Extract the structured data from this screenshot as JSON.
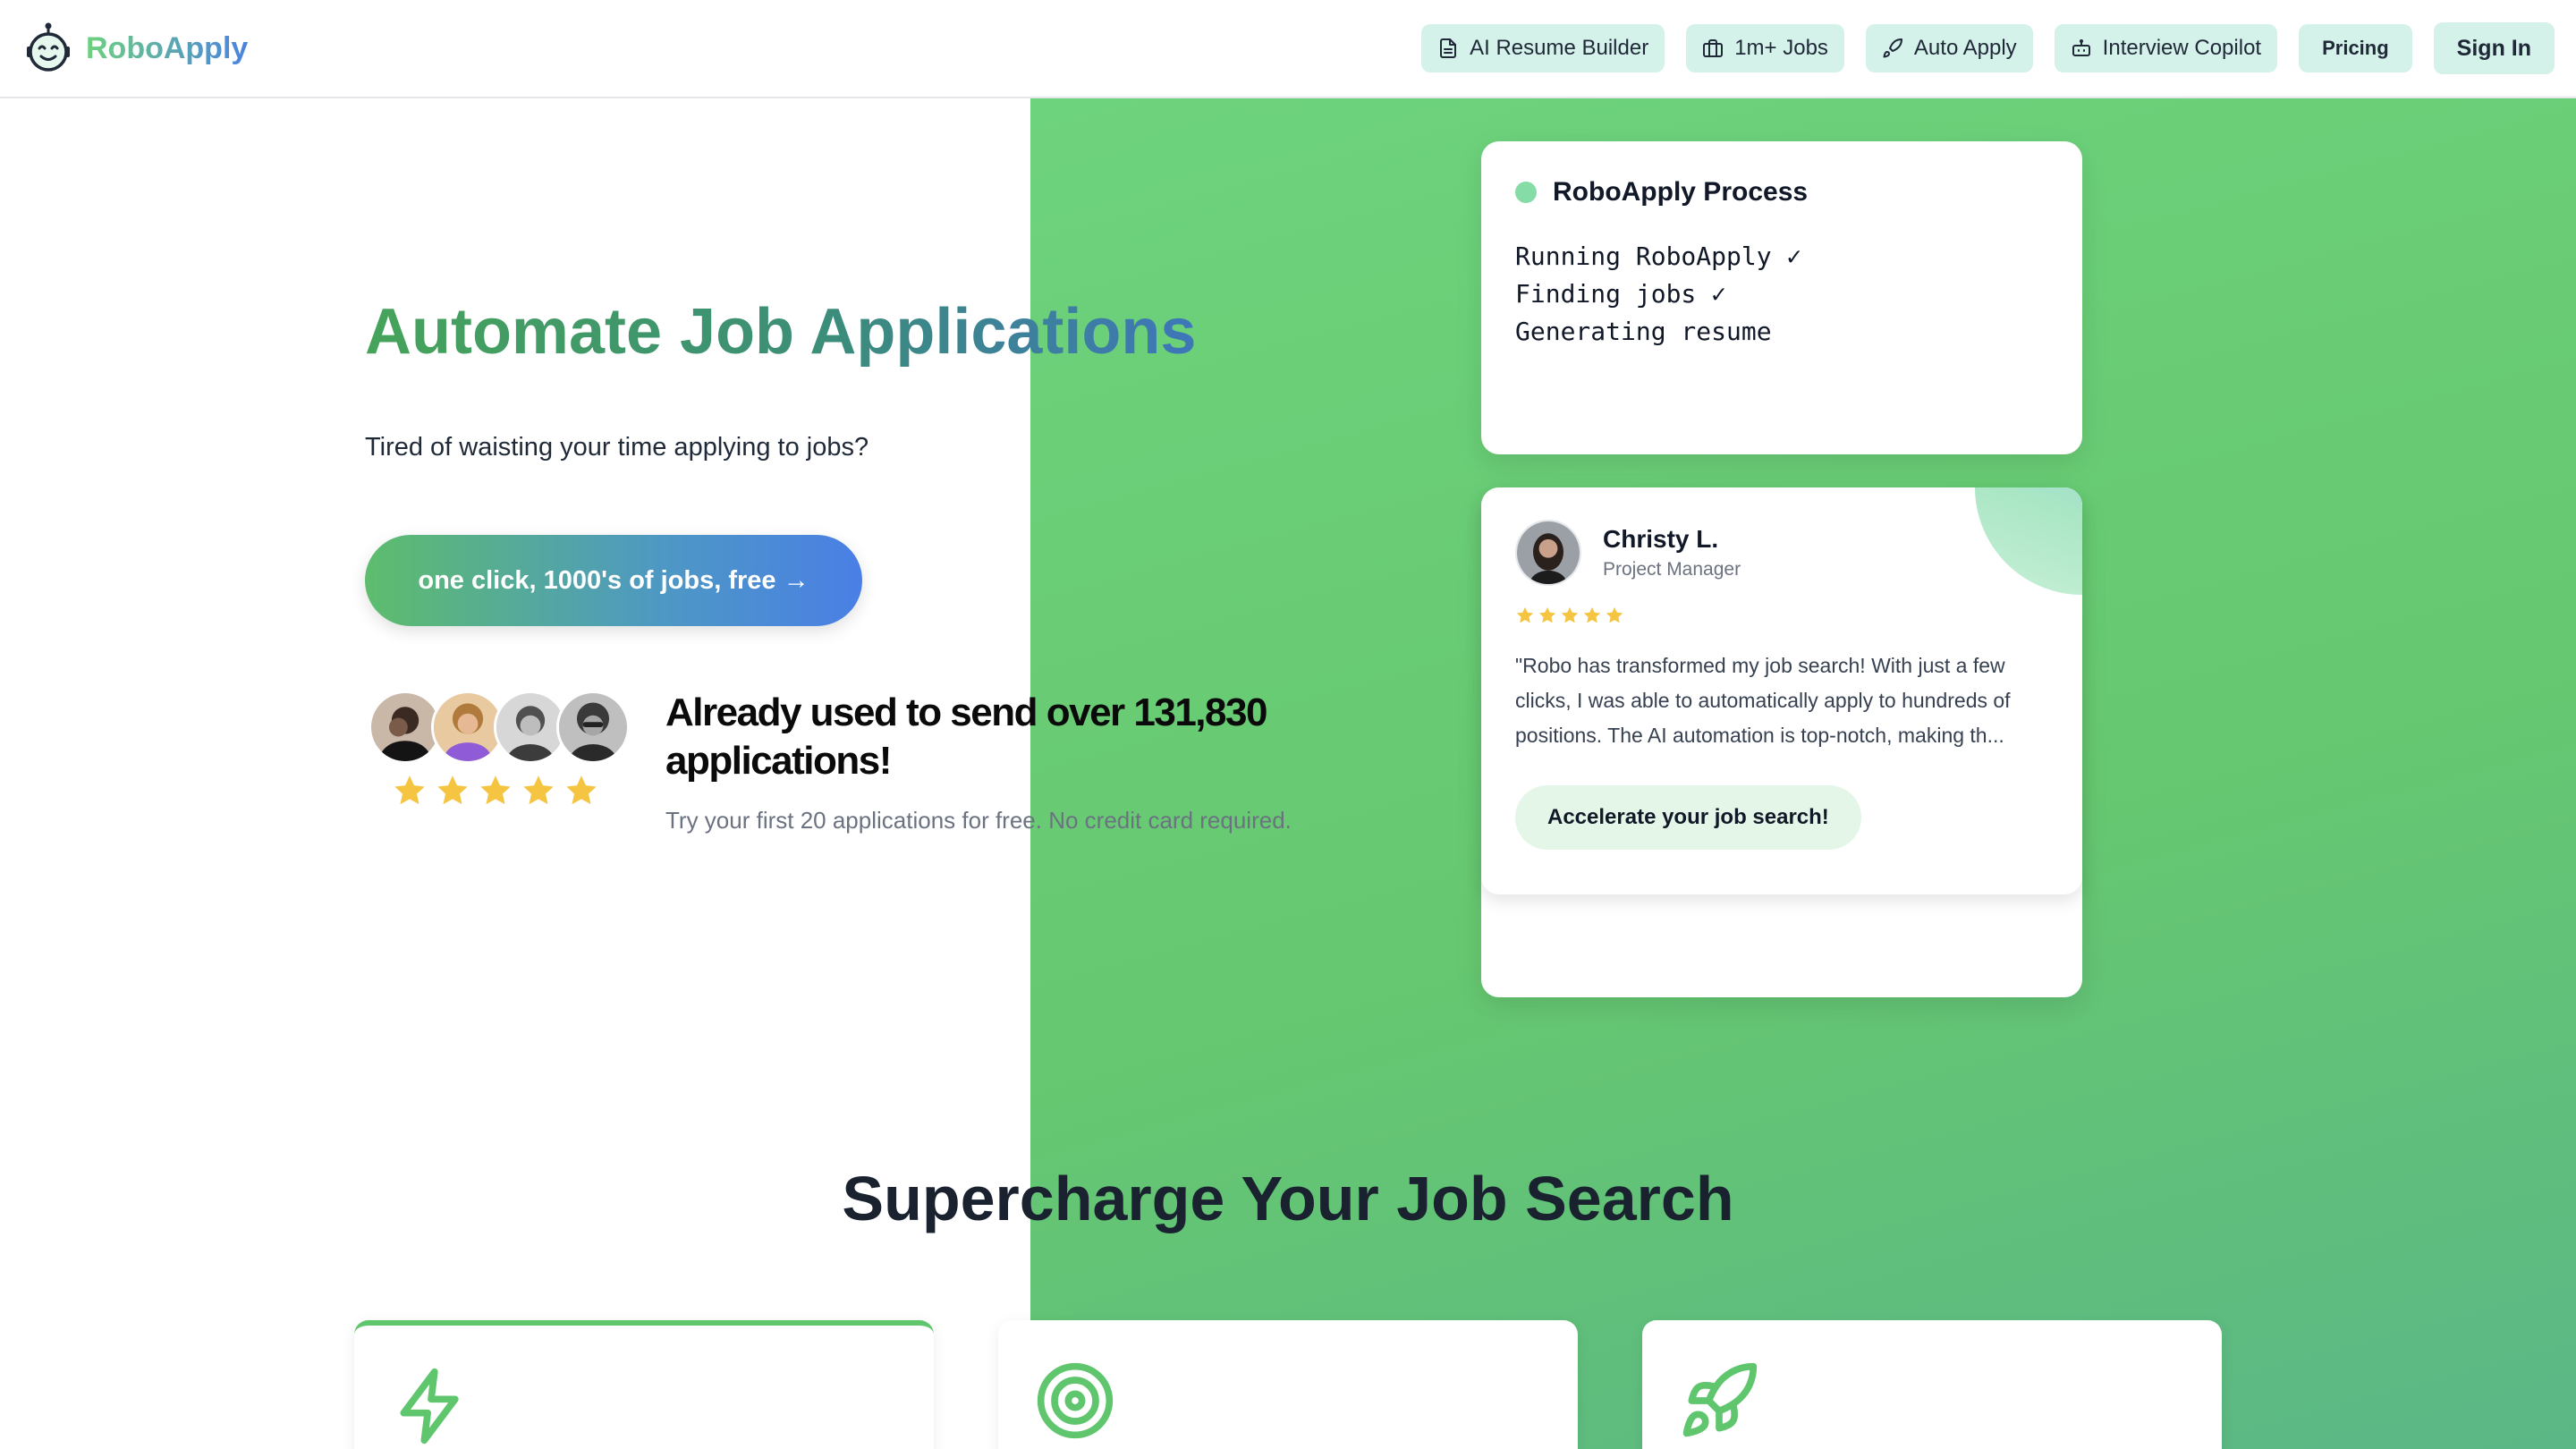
{
  "brand": {
    "name": "RoboApply",
    "logo_icon": "robot-face-icon"
  },
  "nav": {
    "items": [
      {
        "label": "AI Resume Builder",
        "icon": "document-icon"
      },
      {
        "label": "1m+ Jobs",
        "icon": "briefcase-icon"
      },
      {
        "label": "Auto Apply",
        "icon": "rocket-icon"
      },
      {
        "label": "Interview Copilot",
        "icon": "bot-icon"
      }
    ],
    "pricing": "Pricing",
    "signin": "Sign In"
  },
  "hero": {
    "title": "Automate Job Applications",
    "subtitle": "Tired of waisting your time applying to jobs?",
    "cta": "one click, 1000's of jobs, free →",
    "social_title": "Already used to send over 131,830 applications!",
    "social_sub": "Try your first 20 applications for free. No credit card required.",
    "rating": 5
  },
  "process": {
    "title": "RoboApply Process",
    "lines": [
      "Running RoboApply ✓",
      "Finding jobs ✓",
      "Generating resume"
    ]
  },
  "testimonial": {
    "name": "Christy L.",
    "role": "Project Manager",
    "rating": 5,
    "quote": "\"Robo has transformed my job search! With just a few clicks, I was able to automatically apply to hundreds of positions. The AI automation is top-notch, making th...",
    "button": "Accelerate your job search!"
  },
  "section": {
    "title": "Supercharge Your Job Search",
    "features": [
      {
        "icon": "lightning-icon"
      },
      {
        "icon": "target-icon"
      },
      {
        "icon": "rocket-icon"
      }
    ]
  },
  "colors": {
    "accent_green": "#66c870",
    "accent_blue": "#4a7fe6",
    "nav_pill": "#d4f1ea",
    "star": "#f5c542"
  }
}
